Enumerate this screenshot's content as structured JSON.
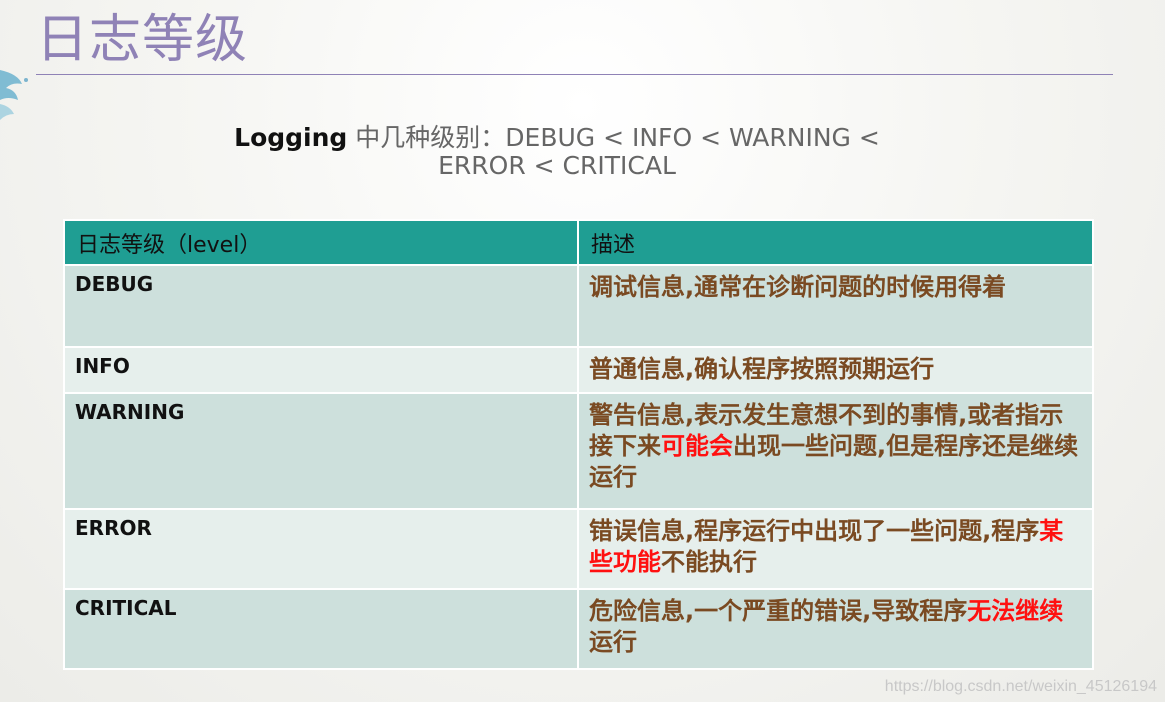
{
  "slide": {
    "title": "日志等级",
    "subtitle": {
      "strong": "Logging",
      "line1_rest": " 中几种级别：DEBUG < INFO < WARNING <",
      "line2": "ERROR < CRITICAL"
    },
    "watermark": "https://blog.csdn.net/weixin_45126194"
  },
  "table": {
    "headers": [
      "日志等级（level）",
      "描述"
    ],
    "rows": [
      {
        "level": "DEBUG",
        "desc_parts": [
          {
            "text": "调试信息,通常在诊断问题的时候用得着",
            "highlight": false
          }
        ]
      },
      {
        "level": "INFO",
        "desc_parts": [
          {
            "text": "普通信息,确认程序按照预期运行",
            "highlight": false
          }
        ]
      },
      {
        "level": "WARNING",
        "desc_parts": [
          {
            "text": "警告信息,表示发生意想不到的事情,或者指示接下来",
            "highlight": false
          },
          {
            "text": "可能会",
            "highlight": true
          },
          {
            "text": "出现一些问题,但是程序还是继续运行",
            "highlight": false
          }
        ]
      },
      {
        "level": "ERROR",
        "desc_parts": [
          {
            "text": "错误信息,程序运行中出现了一些问题,程序",
            "highlight": false
          },
          {
            "text": "某些功能",
            "highlight": true
          },
          {
            "text": "不能执行",
            "highlight": false
          }
        ]
      },
      {
        "level": "CRITICAL",
        "desc_parts": [
          {
            "text": "危险信息,一个严重的错误,导致程序",
            "highlight": false
          },
          {
            "text": "无法继续",
            "highlight": true
          },
          {
            "text": "运行",
            "highlight": false
          }
        ]
      }
    ]
  },
  "colors": {
    "title": "#8f82b6",
    "header_bg": "#1f9e93",
    "row_odd": "#cde0dc",
    "row_even": "#e6efec",
    "desc_text": "#7a4a22",
    "highlight": "#ff1010"
  }
}
